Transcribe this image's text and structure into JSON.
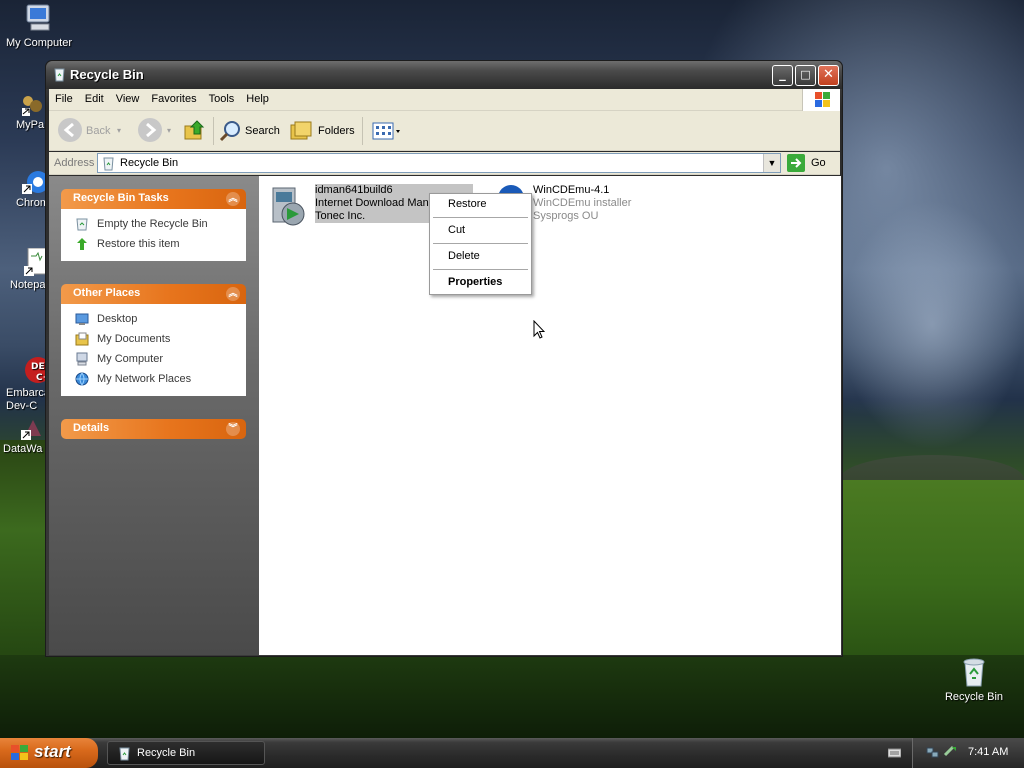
{
  "desktop": {
    "icons": [
      {
        "label": "My Computer"
      },
      {
        "label": "MyPa"
      },
      {
        "label": "Chrom"
      },
      {
        "label": "Notepa"
      },
      {
        "label": "Embarca\nDev-C"
      },
      {
        "label": "DataWa"
      },
      {
        "label": "Recycle Bin"
      }
    ]
  },
  "window": {
    "title": "Recycle Bin",
    "controls": {
      "minimize": "_",
      "maximize": "□",
      "close": "✕"
    }
  },
  "menu": {
    "items": [
      "File",
      "Edit",
      "View",
      "Favorites",
      "Tools",
      "Help"
    ]
  },
  "toolbar": {
    "back_label": "Back",
    "search_label": "Search",
    "folders_label": "Folders"
  },
  "address": {
    "label": "Address",
    "value": "Recycle Bin",
    "go_label": "Go"
  },
  "sidebar": {
    "tasks": {
      "title": "Recycle Bin Tasks",
      "items": [
        "Empty the Recycle Bin",
        "Restore this item"
      ]
    },
    "other_places": {
      "title": "Other Places",
      "items": [
        "Desktop",
        "My Documents",
        "My Computer",
        "My Network Places"
      ]
    },
    "details": {
      "title": "Details"
    }
  },
  "files": [
    {
      "name": "idman641build6",
      "description": "Internet Download Man",
      "company": "Tonec Inc.",
      "selected": true
    },
    {
      "name": "WinCDEmu-4.1",
      "description": "WinCDEmu installer",
      "company": "Sysprogs OU",
      "selected": false
    }
  ],
  "context_menu": {
    "items": [
      "Restore",
      "Cut",
      "Delete",
      "Properties"
    ]
  },
  "taskbar": {
    "start_label": "start",
    "task_label": "Recycle Bin",
    "clock": "7:41 AM"
  },
  "colors": {
    "panel_header": "#e7741c",
    "selection": "#c4c4c4",
    "start_button": "#d96a1c"
  }
}
